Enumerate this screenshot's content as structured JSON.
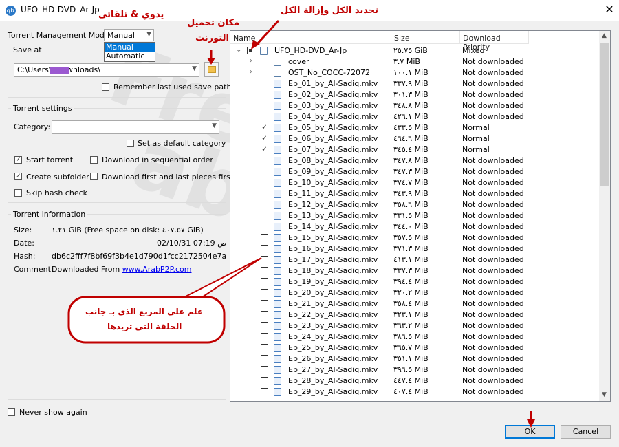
{
  "window": {
    "title": "UFO_HD-DVD_Ar-Jp",
    "close_label": "✕",
    "app_icon_label": "qb"
  },
  "left": {
    "mode_label": "Torrent Management Mode:",
    "mode_value": "Manual",
    "mode_options": [
      "Manual",
      "Automatic"
    ],
    "save_at_label": "Save at",
    "save_path": "C:\\Users\\       \\Downloads\\",
    "remember_label": "Remember last used save path",
    "torrent_settings_label": "Torrent settings",
    "category_label": "Category:",
    "category_value": "",
    "default_category_label": "Set as default category",
    "start_torrent_label": "Start torrent",
    "sequential_label": "Download in sequential order",
    "create_subfolder_label": "Create subfolder",
    "first_last_label": "Download first and last pieces first",
    "skip_hash_label": "Skip hash check",
    "info_label": "Torrent information",
    "size_label": "Size:",
    "size_value": "١.٢١ GiB (Free space on disk: ٤٠٧.٥٧ GiB)",
    "date_label": "Date:",
    "date_value": "02/10/31 07:19 ص",
    "hash_label": "Hash:",
    "hash_value": "db6c2fff7f8bf69f3b4e1d790d1fcc2172504e7a",
    "comment_label": "Comment:",
    "comment_prefix": "Downloaded From ",
    "comment_link": "www.ArabP2P.com",
    "never_show_label": "Never show again"
  },
  "tree": {
    "columns": [
      "Name",
      "Size",
      "Download Priority"
    ],
    "rows": [
      {
        "name": "UFO_HD-DVD_Ar-Jp",
        "size": "٢٥.٧٥ GiB",
        "priority": "Mixed"
      },
      {
        "name": "cover",
        "size": "٣.٧ MiB",
        "priority": "Not downloaded"
      },
      {
        "name": "OST_No_COCC-72072",
        "size": "١٠٠.١ MiB",
        "priority": "Not downloaded"
      },
      {
        "name": "Ep_01_by_Al-Sadiq.mkv",
        "size": "٣٣٧.٩ MiB",
        "priority": "Not downloaded"
      },
      {
        "name": "Ep_02_by_Al-Sadiq.mkv",
        "size": "٣٠١.٣ MiB",
        "priority": "Not downloaded"
      },
      {
        "name": "Ep_03_by_Al-Sadiq.mkv",
        "size": "٣٤٨.٨ MiB",
        "priority": "Not downloaded"
      },
      {
        "name": "Ep_04_by_Al-Sadiq.mkv",
        "size": "٤٢٦.١ MiB",
        "priority": "Not downloaded"
      },
      {
        "name": "Ep_05_by_Al-Sadiq.mkv",
        "size": "٤٣٣.٥ MiB",
        "priority": "Normal"
      },
      {
        "name": "Ep_06_by_Al-Sadiq.mkv",
        "size": "٤٦٤.٦ MiB",
        "priority": "Normal"
      },
      {
        "name": "Ep_07_by_Al-Sadiq.mkv",
        "size": "٣٤٥.٤ MiB",
        "priority": "Normal"
      },
      {
        "name": "Ep_08_by_Al-Sadiq.mkv",
        "size": "٣٤٧.٨ MiB",
        "priority": "Not downloaded"
      },
      {
        "name": "Ep_09_by_Al-Sadiq.mkv",
        "size": "٣٤٧.٣ MiB",
        "priority": "Not downloaded"
      },
      {
        "name": "Ep_10_by_Al-Sadiq.mkv",
        "size": "٣٧٤.٧ MiB",
        "priority": "Not downloaded"
      },
      {
        "name": "Ep_11_by_Al-Sadiq.mkv",
        "size": "٣٤٣.٩ MiB",
        "priority": "Not downloaded"
      },
      {
        "name": "Ep_12_by_Al-Sadiq.mkv",
        "size": "٣٥٨.٦ MiB",
        "priority": "Not downloaded"
      },
      {
        "name": "Ep_13_by_Al-Sadiq.mkv",
        "size": "٣٣١.٥ MiB",
        "priority": "Not downloaded"
      },
      {
        "name": "Ep_14_by_Al-Sadiq.mkv",
        "size": "٣٤٤.٠ MiB",
        "priority": "Not downloaded"
      },
      {
        "name": "Ep_15_by_Al-Sadiq.mkv",
        "size": "٣٥٧.٥ MiB",
        "priority": "Not downloaded"
      },
      {
        "name": "Ep_16_by_Al-Sadiq.mkv",
        "size": "٣٧١.٣ MiB",
        "priority": "Not downloaded"
      },
      {
        "name": "Ep_17_by_Al-Sadiq.mkv",
        "size": "٤١٣.١ MiB",
        "priority": "Not downloaded"
      },
      {
        "name": "Ep_18_by_Al-Sadiq.mkv",
        "size": "٣٣٧.٣ MiB",
        "priority": "Not downloaded"
      },
      {
        "name": "Ep_19_by_Al-Sadiq.mkv",
        "size": "٣٩٤.٤ MiB",
        "priority": "Not downloaded"
      },
      {
        "name": "Ep_20_by_Al-Sadiq.mkv",
        "size": "٣٢٠.٢ MiB",
        "priority": "Not downloaded"
      },
      {
        "name": "Ep_21_by_Al-Sadiq.mkv",
        "size": "٣٥٨.٤ MiB",
        "priority": "Not downloaded"
      },
      {
        "name": "Ep_22_by_Al-Sadiq.mkv",
        "size": "٣٢٣.١ MiB",
        "priority": "Not downloaded"
      },
      {
        "name": "Ep_23_by_Al-Sadiq.mkv",
        "size": "٣٦٣.٢ MiB",
        "priority": "Not downloaded"
      },
      {
        "name": "Ep_24_by_Al-Sadiq.mkv",
        "size": "٣٨٦.٥ MiB",
        "priority": "Not downloaded"
      },
      {
        "name": "Ep_25_by_Al-Sadiq.mkv",
        "size": "٣٦٥.٧ MiB",
        "priority": "Not downloaded"
      },
      {
        "name": "Ep_26_by_Al-Sadiq.mkv",
        "size": "٣٥١.١ MiB",
        "priority": "Not downloaded"
      },
      {
        "name": "Ep_27_by_Al-Sadiq.mkv",
        "size": "٣٩٦.٥ MiB",
        "priority": "Not downloaded"
      },
      {
        "name": "Ep_28_by_Al-Sadiq.mkv",
        "size": "٤٤٧.٤ MiB",
        "priority": "Not downloaded"
      },
      {
        "name": "Ep_29_by_Al-Sadiq.mkv",
        "size": "٤٠٧.٤ MiB",
        "priority": "Not downloaded"
      }
    ]
  },
  "buttons": {
    "ok": "OK",
    "cancel": "Cancel"
  },
  "annotations": {
    "select_all": "تحديد الكل وإزالة الكل",
    "manual_auto": "يدوي & تلقائي",
    "save_location_1": "مكان تحميل",
    "save_location_2": "التورنت",
    "bubble_1": "علم على المربع الذي بـ جانب",
    "bubble_2": "الحلقة التي تريدها"
  },
  "colors": {
    "annotation": "#c00000",
    "ok_border": "#0078d7",
    "link": "#0000ee",
    "redaction": "#9b59d0"
  }
}
